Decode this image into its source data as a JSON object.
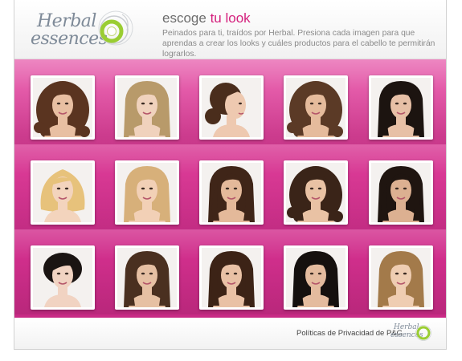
{
  "header": {
    "logo_line1": "Herbal",
    "logo_line2": "essences",
    "title_prefix": "escoge",
    "title_highlight": "tu look",
    "description": "Peinados para ti, traídos por Herbal. Presiona cada imagen para que aprendas a crear los looks y cuáles productos para el cabello te permitirán lograrlos."
  },
  "gallery": {
    "rows": [
      [
        {
          "name": "look-1",
          "hair": "#5a3420",
          "skin": "#e8bfa2",
          "style": "curly-long"
        },
        {
          "name": "look-2",
          "hair": "#b89a6a",
          "skin": "#f0d2bd",
          "style": "wavy-long"
        },
        {
          "name": "look-3",
          "hair": "#4a2d1c",
          "skin": "#eec9b0",
          "style": "updo-profile"
        },
        {
          "name": "look-4",
          "hair": "#5b3a26",
          "skin": "#e5bb9c",
          "style": "curly-long"
        },
        {
          "name": "look-5",
          "hair": "#1c1410",
          "skin": "#e7c0a6",
          "style": "wavy-long"
        }
      ],
      [
        {
          "name": "look-6",
          "hair": "#e7c27b",
          "skin": "#f3d4bd",
          "style": "bob"
        },
        {
          "name": "look-7",
          "hair": "#d7b07a",
          "skin": "#f2d0b6",
          "style": "wavy-long"
        },
        {
          "name": "look-8",
          "hair": "#3f2518",
          "skin": "#e4b99a",
          "style": "wavy-long"
        },
        {
          "name": "look-9",
          "hair": "#3a2418",
          "skin": "#e9c2a4",
          "style": "curly-long"
        },
        {
          "name": "look-10",
          "hair": "#1f1510",
          "skin": "#dcb091",
          "style": "wavy-long"
        }
      ],
      [
        {
          "name": "look-11",
          "hair": "#1a1412",
          "skin": "#f1d3c2",
          "style": "pixie"
        },
        {
          "name": "look-12",
          "hair": "#4a3020",
          "skin": "#e6c0a3",
          "style": "straight-long"
        },
        {
          "name": "look-13",
          "hair": "#3c2316",
          "skin": "#e9c1a5",
          "style": "straight-long"
        },
        {
          "name": "look-14",
          "hair": "#15100e",
          "skin": "#e4bb9e",
          "style": "straight-long"
        },
        {
          "name": "look-15",
          "hair": "#a37a4a",
          "skin": "#efcdb2",
          "style": "wavy-long"
        }
      ]
    ]
  },
  "footer": {
    "privacy_link": "Políticas de Privacidad de P&G",
    "logo_line1": "Herbal",
    "logo_line2": "essences"
  },
  "colors": {
    "accent": "#d4207d",
    "stage_top": "#e96cb4",
    "stage_bottom": "#c82a85",
    "logo_green": "#9acd32"
  }
}
